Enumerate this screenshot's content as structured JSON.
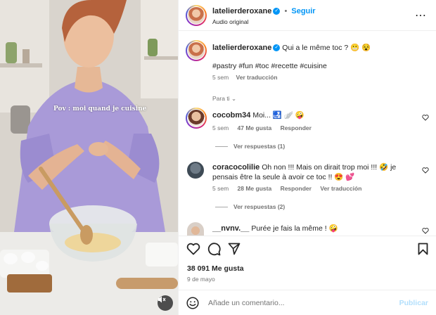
{
  "post": {
    "username": "latelierderoxane",
    "follow_label": "Seguir",
    "audio": "Audio original",
    "caption": "Qui a le même toc ? 😬 😵",
    "hashtags": "#pastry #fun #toc #recette #cuisine",
    "caption_time": "5 sem",
    "caption_translate": "Ver traducción",
    "overlay_text": "Pov : moi quand je cuisine",
    "likes": "38 091 Me gusta",
    "date": "9 de mayo",
    "comment_placeholder": "Añade un comentario...",
    "publish_label": "Publicar"
  },
  "for_you_label": "Para ti",
  "comments": [
    {
      "username": "cocobm34",
      "text": "Moi... 🛃 🪽 🤪",
      "time": "5 sem",
      "likes": "47 Me gusta",
      "reply": "Responder",
      "replies": "Ver respuestas (1)"
    },
    {
      "username": "coracocolilie",
      "text_line1": "Oh non !!! Mais on dirait trop moi !!! 🤣 je",
      "text_line2": "pensais être la seule à avoir ce toc !! 😍 💕",
      "time": "5 sem",
      "likes": "28 Me gusta",
      "reply": "Responder",
      "translate": "Ver traducción",
      "replies": "Ver respuestas (2)"
    },
    {
      "username": "__nvnv.__",
      "text": "Purée je fais la même ! 🤪"
    }
  ],
  "icons": [
    "more-icon",
    "heart-icon",
    "comment-icon",
    "share-icon",
    "save-icon",
    "smiley-icon",
    "mute-icon",
    "verified-icon",
    "chevron-down-icon"
  ],
  "colors": {
    "link": "#0095f6",
    "secondary": "#737373",
    "text": "#262626"
  }
}
